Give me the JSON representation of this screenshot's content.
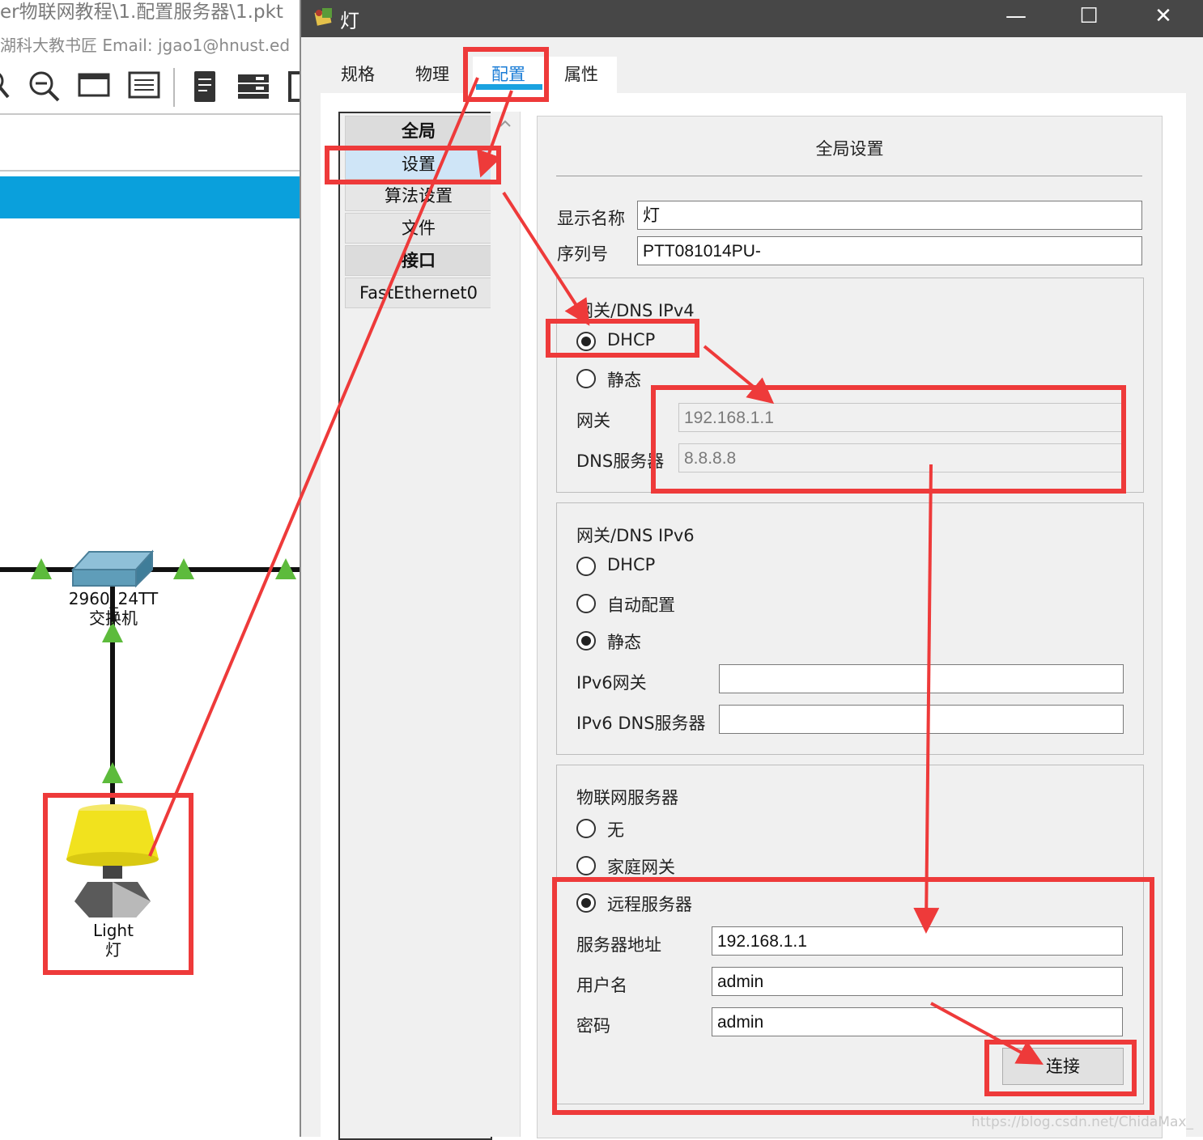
{
  "background_app": {
    "title": "er物联网教程\\1.配置服务器\\1.pkt",
    "author": "湖科大教书匠  Email: jgao1@hnust.ed",
    "toolbar_icons": [
      "search-icon",
      "zoom-out-icon",
      "window-icon",
      "list-icon",
      "document-icon",
      "device-icon",
      "image-icon"
    ],
    "switch": {
      "model": "2960_24TT",
      "type": "交换机"
    },
    "light": {
      "name": "Light",
      "cn_name": "灯"
    }
  },
  "dialog": {
    "title": "灯",
    "controls": {
      "minimize": "—",
      "maximize": "☐",
      "close": "✕"
    },
    "tabs": [
      "规格",
      "物理",
      "配置",
      "属性"
    ],
    "active_tab": "配置",
    "nav": [
      "全局",
      "设置",
      "算法设置",
      "文件",
      "接口",
      "FastEthernet0"
    ],
    "selected_nav": "设置",
    "panel_title": "全局设置",
    "display_name": {
      "label": "显示名称",
      "value": "灯"
    },
    "serial": {
      "label": "序列号",
      "value": "PTT081014PU-"
    },
    "ipv4": {
      "title": "网关/DNS IPv4",
      "dhcp": "DHCP",
      "static": "静态",
      "selected": "DHCP",
      "gateway_label": "网关",
      "gateway": "192.168.1.1",
      "dns_label": "DNS服务器",
      "dns": "8.8.8.8"
    },
    "ipv6": {
      "title": "网关/DNS IPv6",
      "dhcp": "DHCP",
      "auto": "自动配置",
      "static": "静态",
      "selected": "静态",
      "gateway_label": "IPv6网关",
      "gateway": "",
      "dns_label": "IPv6 DNS服务器",
      "dns": ""
    },
    "iot": {
      "title": "物联网服务器",
      "none": "无",
      "home_gateway": "家庭网关",
      "remote": "远程服务器",
      "selected": "远程服务器",
      "server_label": "服务器地址",
      "server": "192.168.1.1",
      "user_label": "用户名",
      "user": "admin",
      "password_label": "密码",
      "password": "admin",
      "connect": "连接"
    }
  },
  "watermark": "https://blog.csdn.net/ChidaMax_",
  "colors": {
    "annotation": "#ee3a3a",
    "titlebar": "#474747",
    "blue_bar": "#0aa0dc",
    "tab_active": "#1a7cd6",
    "link_triangle": "#5dbb3c"
  }
}
